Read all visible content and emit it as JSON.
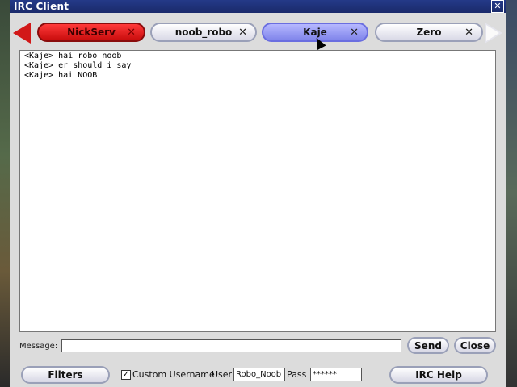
{
  "window": {
    "title": "IRC Client",
    "close_symbol": "✕"
  },
  "tabs": [
    {
      "label": "NickServ",
      "close": "✕",
      "color": "#d21818"
    },
    {
      "label": "noob_robo",
      "close": "✕"
    },
    {
      "label": "Kaje",
      "close": "✕",
      "active": true,
      "color": "#8f94f2"
    },
    {
      "label": "Zero",
      "close": "✕"
    }
  ],
  "chat": {
    "lines": [
      "<Kaje> hai robo noob",
      "<Kaje> er should i say",
      "<Kaje> hai NOOB"
    ]
  },
  "composer": {
    "label": "Message:",
    "value": "",
    "send": "Send",
    "close": "Close"
  },
  "footer": {
    "filters": "Filters",
    "custom_username": {
      "label": "Custom Username",
      "checked": true,
      "check": "✓"
    },
    "user_label": "User",
    "user_value": "Robo_Noob",
    "pass_label": "Pass",
    "pass_value": "******",
    "help": "IRC Help"
  }
}
